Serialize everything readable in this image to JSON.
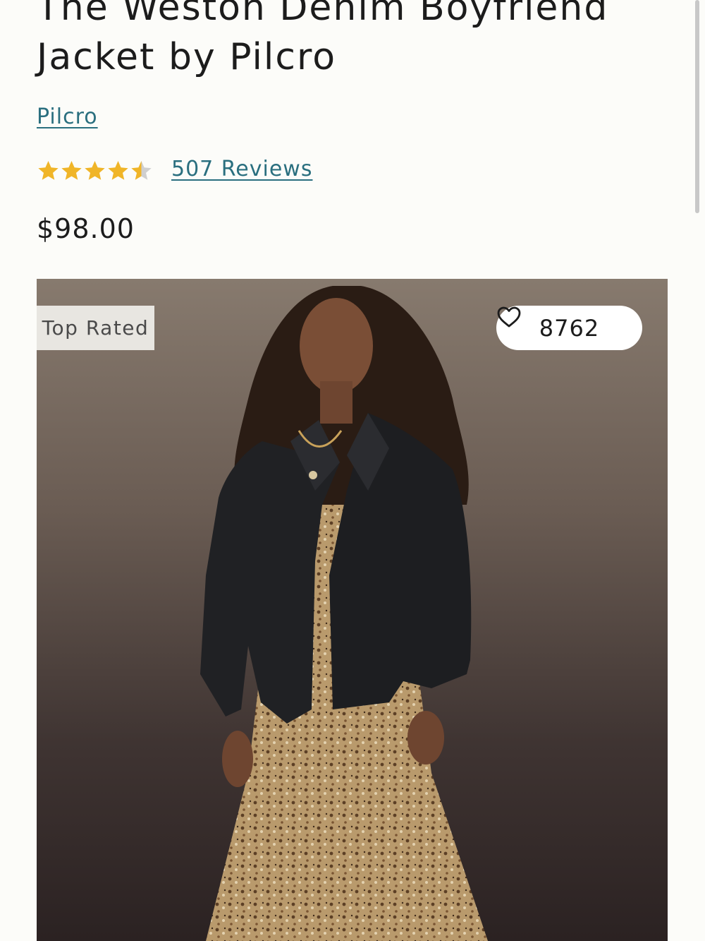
{
  "product": {
    "title": "The Weston Denim Boyfriend Jacket by Pilcro",
    "brand": "Pilcro",
    "rating": 4.5,
    "rating_max": 5,
    "reviews_label": "507 Reviews",
    "price": "$98.00"
  },
  "image": {
    "badge": "Top Rated",
    "wishlist_count": "8762",
    "wishlist_icon": "heart-outline-icon",
    "subject": "model-wearing-black-denim-jacket-over-floral-dress"
  },
  "colors": {
    "link": "#2a6f7f",
    "star": "#f0b528",
    "star_empty": "#cfcfcf",
    "background": "#fcfcf9",
    "badge_bg": "#e8e6e1"
  }
}
